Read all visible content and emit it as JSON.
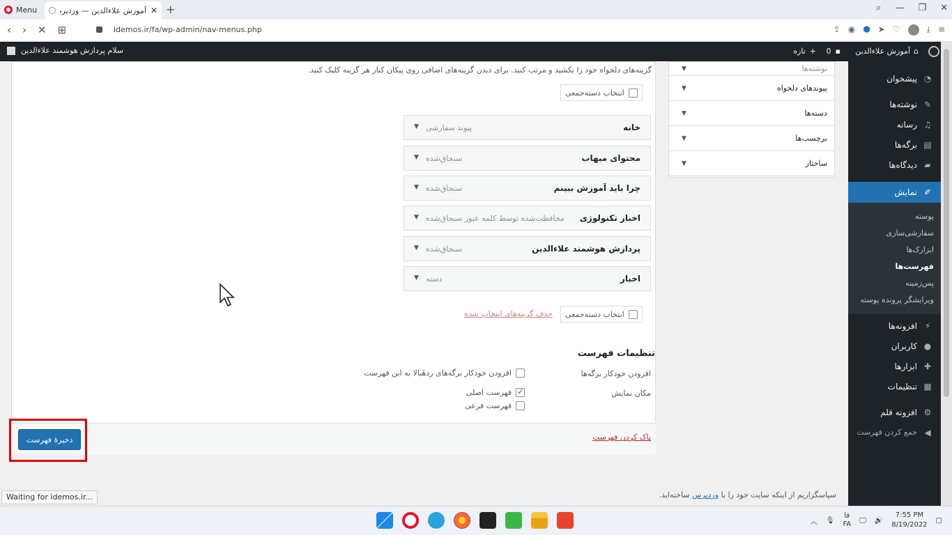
{
  "browser": {
    "menu_label": "Menu",
    "tab_title": "آموزش علاءالدین — وردپرس",
    "tab_close": "✕",
    "new_tab": "+",
    "url": "idemos.ir/fa/wp-admin/nav-menus.php",
    "status": "Waiting for idemos.ir..."
  },
  "adminbar": {
    "site_name": "آموزش علاءالدین",
    "comments_count": "0",
    "new_label": "تازه",
    "howdy": "سلام پردازش هوشمند علاءالدین"
  },
  "sidebar": {
    "items": [
      {
        "label": "پیشخوان",
        "icon": "dashboard-icon"
      },
      {
        "label": "نوشته‌ها",
        "icon": "pin-icon"
      },
      {
        "label": "رسانه",
        "icon": "media-icon"
      },
      {
        "label": "برگه‌ها",
        "icon": "page-icon"
      },
      {
        "label": "دیدگاه‌ها",
        "icon": "comment-icon"
      },
      {
        "label": "نمایش",
        "icon": "appearance-icon"
      }
    ],
    "submenu": [
      "پوسته",
      "سفارشی‌سازی",
      "ابزارک‌ها",
      "فهرست‌ها",
      "پس‌زمینه",
      "ویرایشگر پرونده پوسته"
    ],
    "items_after": [
      {
        "label": "افزونه‌ها",
        "icon": "plugin-icon"
      },
      {
        "label": "کاربران",
        "icon": "user-icon"
      },
      {
        "label": "ابزارها",
        "icon": "tools-icon"
      },
      {
        "label": "تنظیمات",
        "icon": "settings-icon"
      },
      {
        "label": "افزونه قلم",
        "icon": "gear-icon"
      }
    ],
    "collapse": "جمع کردن فهرست"
  },
  "main": {
    "instructions": "گزینه‌های دلخواه خود را بکشید و مرتب کنید. برای دیدن گزینه‌های اضافی روی پیکان کنار هر گزینه کلیک کنید.",
    "bulk_select": "انتخاب دسته‌جمعی",
    "remove_selected": "حذف گزینه‌های انتخاب شده",
    "menu_items": [
      {
        "title": "خانه",
        "type": "پیوند سفارشی"
      },
      {
        "title": "محتوای مبهاب",
        "type": "سنجاق‌شده"
      },
      {
        "title": "چرا باید آموزش ببینم",
        "type": "سنجاق‌شده"
      },
      {
        "title": "اخبار تکنولوژی",
        "type": "محافظت‌شده توسط کلمه عبور سنجاق‌شده"
      },
      {
        "title": "پردازش هوشمند علاءالدین",
        "type": "سنجاق‌شده"
      },
      {
        "title": "اخبار",
        "type": "دسته"
      }
    ],
    "settings_title": "تنظیمات فهرست",
    "auto_add_label": "افزودن خودکار برگه‌ها",
    "auto_add_option": "افزودن خودکار برگه‌های ردهٔبالا به این فهرست",
    "location_label": "مکان نمایش",
    "locations": [
      {
        "label": "فهرست اصلی",
        "checked": true
      },
      {
        "label": "فهرست فرعی",
        "checked": false
      }
    ],
    "delete_menu": "پاک کردن فهرست",
    "save_button": "ذخیرهٔ فهرست"
  },
  "meta_box": [
    "نوشته‌ها",
    "پیوندهای دلخواه",
    "دسته‌ها",
    "برچسب‌ها",
    "ساختار"
  ],
  "footer": {
    "thanks_prefix": "سپاسگزاریم از اینکه سایت خود را با",
    "thanks_link": "وردپرس",
    "thanks_suffix": "ساخته‌اید."
  },
  "taskbar": {
    "lang": "FA",
    "lang_short": "فا",
    "time": "7:55 PM",
    "date": "8/19/2022"
  },
  "colors": {
    "accent": "#2271b1",
    "admin_dark": "#1d2327",
    "highlight_red": "#e00000"
  }
}
